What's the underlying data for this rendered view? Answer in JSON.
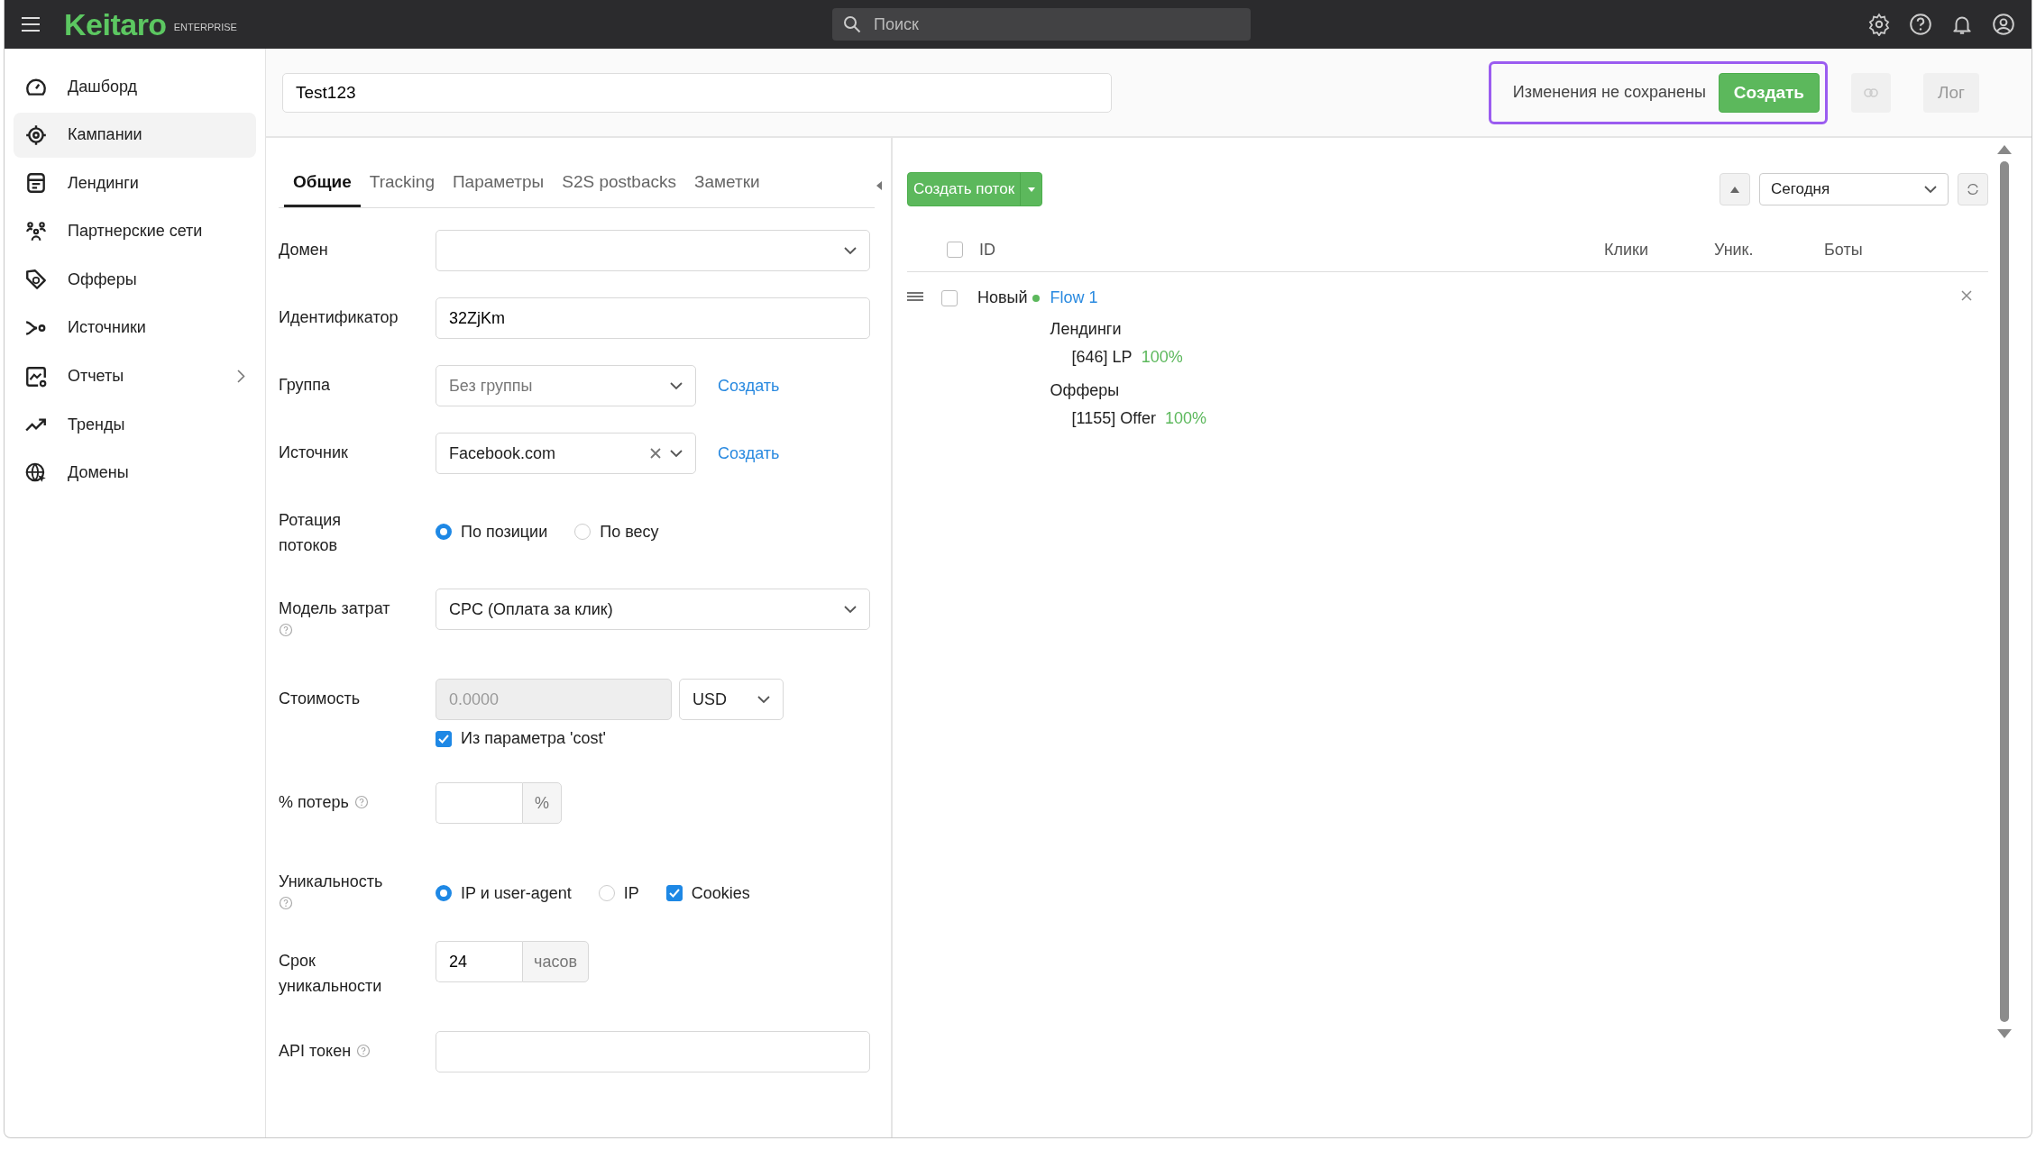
{
  "topbar": {
    "logo": "Keitaro",
    "edition": "ENTERPRISE",
    "search": {
      "placeholder": "Поиск"
    }
  },
  "sidebar": {
    "items": [
      {
        "kind": "dashboard",
        "label": "Дашборд",
        "selected": false,
        "submenu": false
      },
      {
        "kind": "campaigns",
        "label": "Кампании",
        "selected": true,
        "submenu": false
      },
      {
        "kind": "landings",
        "label": "Лендинги",
        "selected": false,
        "submenu": false
      },
      {
        "kind": "partners",
        "label": "Партнерские сети",
        "selected": false,
        "submenu": false
      },
      {
        "kind": "offers",
        "label": "Офферы",
        "selected": false,
        "submenu": false
      },
      {
        "kind": "sources",
        "label": "Источники",
        "selected": false,
        "submenu": false
      },
      {
        "kind": "reports",
        "label": "Отчеты",
        "selected": false,
        "submenu": true
      },
      {
        "kind": "trends",
        "label": "Тренды",
        "selected": false,
        "submenu": false
      },
      {
        "kind": "domains",
        "label": "Домены",
        "selected": false,
        "submenu": false
      }
    ]
  },
  "campaign_name": "Test123",
  "save_bar": {
    "status": "Изменения не сохранены",
    "button": "Создать"
  },
  "log_button": {
    "label": "Лог",
    "disabled": true
  },
  "tabs": [
    {
      "label": "Общие",
      "selected": true
    },
    {
      "label": "Tracking",
      "selected": false
    },
    {
      "label": "Параметры",
      "selected": false
    },
    {
      "label": "S2S postbacks",
      "selected": false
    },
    {
      "label": "Заметки",
      "selected": false
    }
  ],
  "form": [
    {
      "kind": "select",
      "label": "Домен"
    },
    {
      "kind": "text",
      "label": "Идентификатор",
      "value": "32ZjKm"
    },
    {
      "kind": "select",
      "label": "Группа",
      "placeholder": "Без группы",
      "link": "Создать"
    },
    {
      "kind": "select",
      "label": "Источник",
      "value": "Facebook.com",
      "clearable": true,
      "link": "Создать"
    },
    {
      "kind": "choices",
      "label": "Ротация потоков",
      "options": [
        {
          "kind": "radio",
          "label": "По позиции",
          "selected": true
        },
        {
          "kind": "radio",
          "label": "По весу",
          "selected": false
        }
      ]
    },
    {
      "kind": "select",
      "label": "Модель затрат",
      "value": "CPC (Оплата за клик)",
      "help": true
    },
    {
      "kind": "cost",
      "label": "Стоимость",
      "placeholder": "0.0000",
      "disabled": true,
      "currency": "USD",
      "checkbox": {
        "label": "Из параметра 'cost'",
        "checked": true
      }
    },
    {
      "kind": "addon",
      "label": "% потерь",
      "addon": "%",
      "help": true
    },
    {
      "kind": "choices",
      "label": "Уникальность",
      "help": true,
      "options": [
        {
          "kind": "radio",
          "label": "IP и user-agent",
          "selected": true
        },
        {
          "kind": "radio",
          "label": "IP",
          "selected": false
        },
        {
          "kind": "checkbox",
          "label": "Cookies",
          "checked": true
        }
      ]
    },
    {
      "kind": "addon",
      "label": "Срок уникальности",
      "value": "24",
      "addon": "часов"
    },
    {
      "kind": "text",
      "label": "API токен",
      "help": true
    }
  ],
  "flows_panel": {
    "create_button": "Создать поток",
    "period": "Сегодня",
    "columns": [
      "ID",
      "Клики",
      "Уник.",
      "Боты"
    ],
    "all_checked": false,
    "flows": [
      {
        "checked": false,
        "status": "Новый",
        "color": "#5cb85c",
        "name": "Flow 1",
        "groups": [
          {
            "title": "Лендинги",
            "items": [
              {
                "name": "[646] LP",
                "share": "100%"
              }
            ]
          },
          {
            "title": "Офферы",
            "items": [
              {
                "name": "[1155] Offer",
                "share": "100%"
              }
            ]
          }
        ]
      }
    ]
  }
}
